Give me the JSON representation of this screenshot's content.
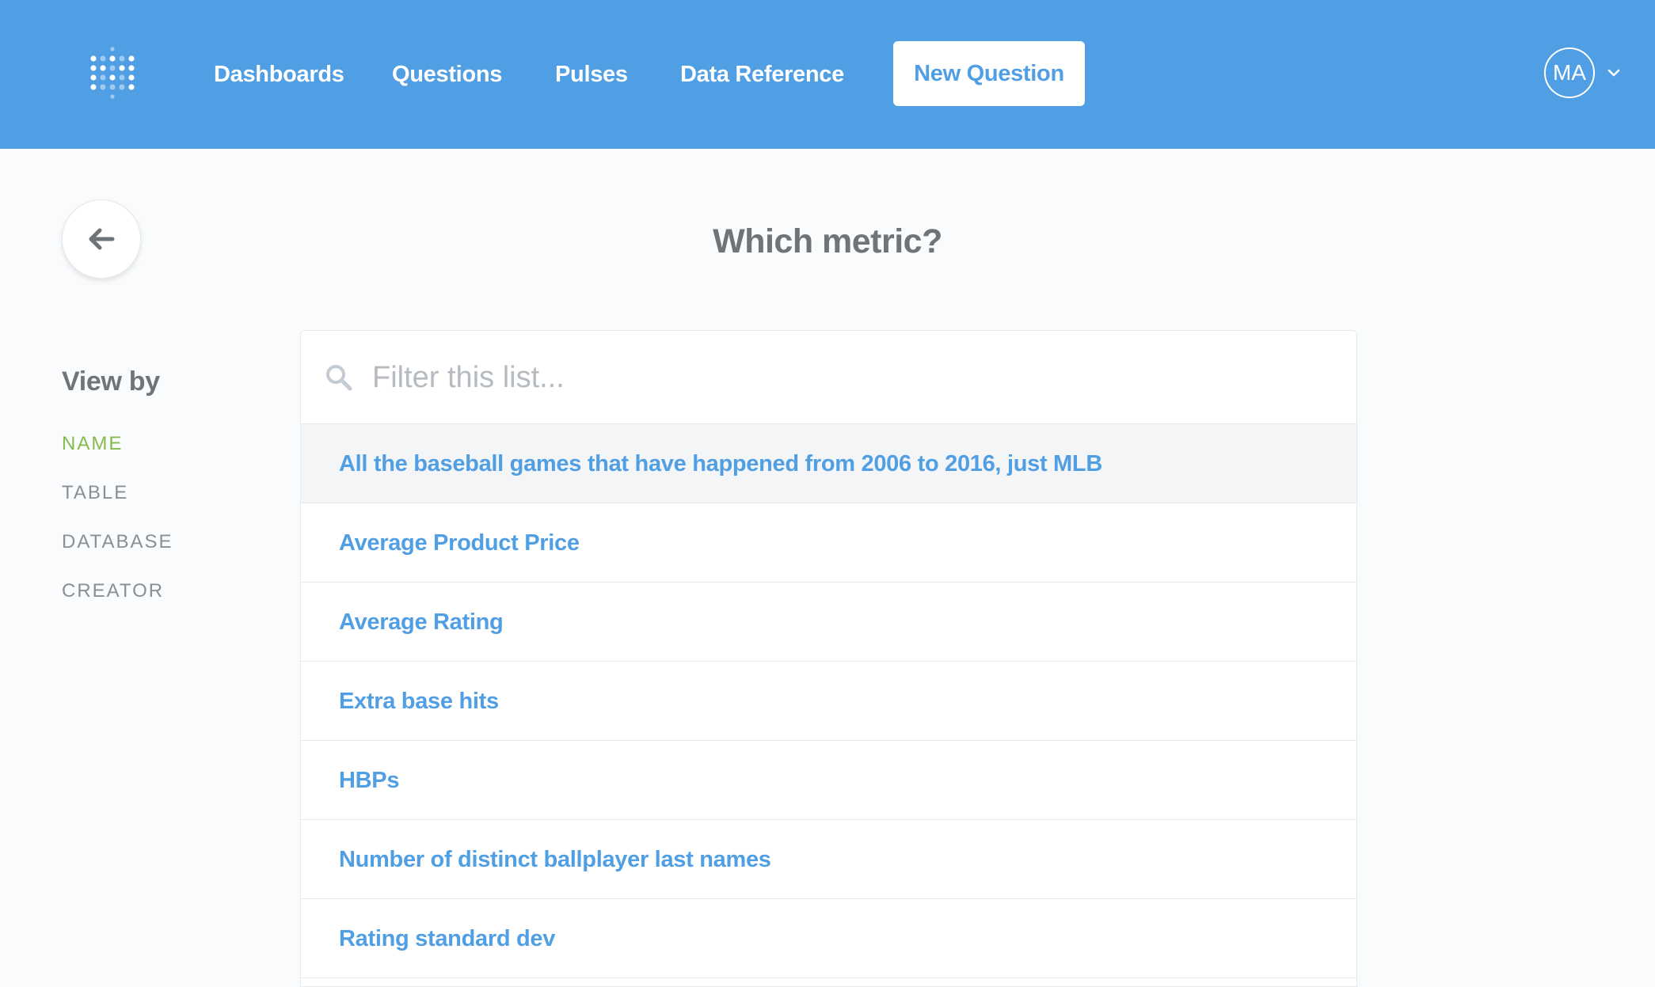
{
  "colors": {
    "nav_background": "#509ee3",
    "accent": "#509ee3",
    "active_option": "#84bb4c",
    "page_background": "#f9fbfc"
  },
  "nav": {
    "logo_icon": "metabase-logo-icon",
    "links": [
      "Dashboards",
      "Questions",
      "Pulses",
      "Data Reference"
    ],
    "new_question_label": "New Question",
    "user_initials": "MA",
    "user_menu_icon": "chevron-down-icon"
  },
  "back_icon": "arrow-left-icon",
  "page_title": "Which metric?",
  "view_by": {
    "heading": "View by",
    "options": [
      "NAME",
      "TABLE",
      "DATABASE",
      "CREATOR"
    ],
    "active": "NAME"
  },
  "search": {
    "icon": "search-icon",
    "placeholder": "Filter this list...",
    "value": ""
  },
  "metrics": [
    "All the baseball games that have happened from 2006 to 2016, just MLB",
    "Average Product Price",
    "Average Rating",
    "Extra base hits",
    "HBPs",
    "Number of distinct ballplayer last names",
    "Rating standard dev"
  ]
}
